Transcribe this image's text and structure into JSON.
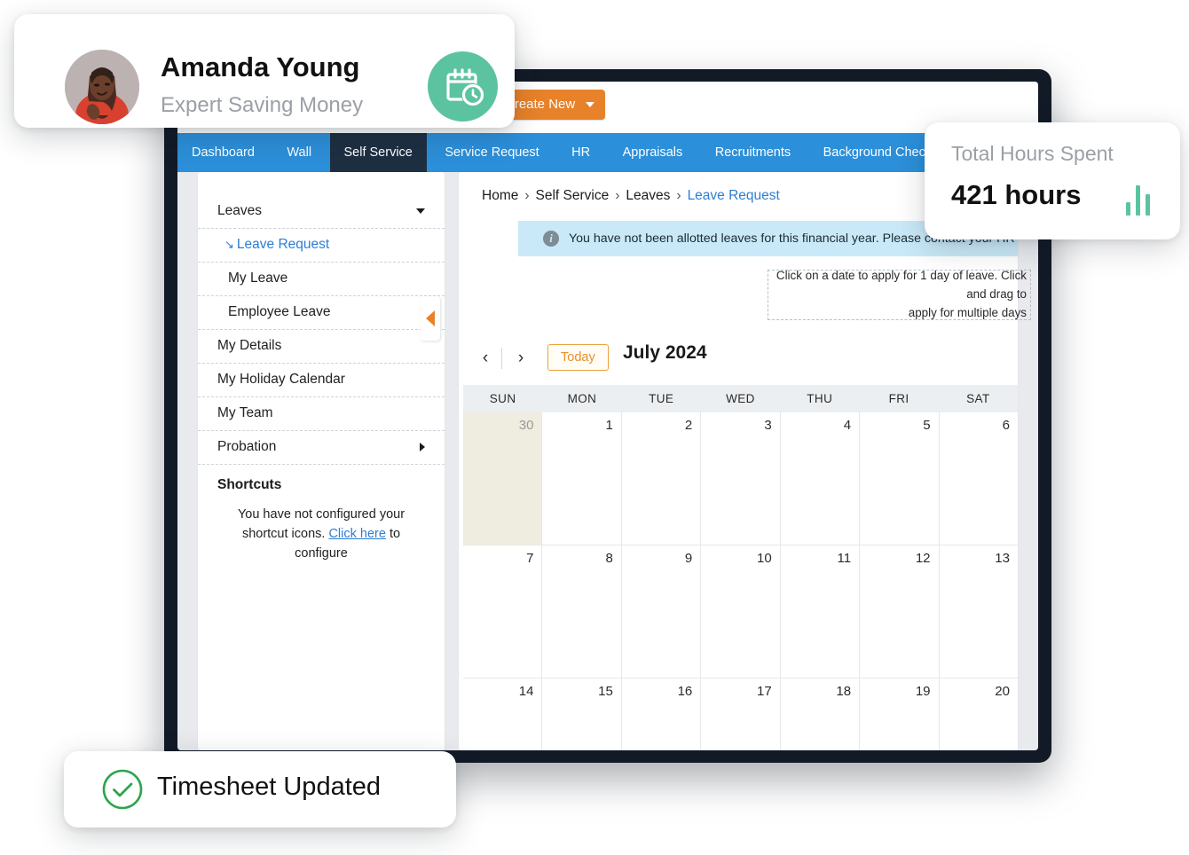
{
  "profile_card": {
    "name": "Amanda Young",
    "role": "Expert Saving Money",
    "badge_icon": "calendar-clock-icon",
    "avatar_icon": "user-avatar-photo",
    "badge_color": "#5cc3a0"
  },
  "hours_card": {
    "label": "Total Hours Spent",
    "value": "421 hours",
    "chart_icon": "bar-chart-icon",
    "accent_color": "#5cc3a0"
  },
  "toast": {
    "message": "Timesheet Updated",
    "icon": "check-circle-icon",
    "accent_color": "#2ba54f"
  },
  "topbar": {
    "create_new_label": "Create New",
    "create_new_color": "#e8822a"
  },
  "nav": {
    "active": "Self Service",
    "accent_color": "#2c8fd9",
    "active_color": "#1e2f42",
    "items": [
      {
        "label": "Dashboard",
        "active": false
      },
      {
        "label": "Wall",
        "active": false
      },
      {
        "label": "Self Service",
        "active": true
      },
      {
        "label": "Service Request",
        "active": false
      },
      {
        "label": "HR",
        "active": false
      },
      {
        "label": "Appraisals",
        "active": false
      },
      {
        "label": "Recruitments",
        "active": false
      },
      {
        "label": "Background Check",
        "active": false
      }
    ]
  },
  "sidebar": {
    "menu": [
      {
        "label": "Leaves",
        "type": "group",
        "caret": "down"
      },
      {
        "label": "Leave Request",
        "type": "sub",
        "active": true
      },
      {
        "label": "My Leave",
        "type": "sub",
        "active": false
      },
      {
        "label": "Employee Leave",
        "type": "sub",
        "active": false
      },
      {
        "label": "My Details",
        "type": "item"
      },
      {
        "label": "My Holiday Calendar",
        "type": "item"
      },
      {
        "label": "My Team",
        "type": "item"
      },
      {
        "label": "Probation",
        "type": "item",
        "caret": "right"
      }
    ],
    "shortcuts": {
      "title": "Shortcuts",
      "text_before": "You have not configured your shortcut icons. ",
      "link": "Click here",
      "text_after": " to configure"
    },
    "collapse_icon": "collapse-left-arrow-icon"
  },
  "content": {
    "breadcrumb": [
      "Home",
      "Self Service",
      "Leaves",
      "Leave Request"
    ],
    "breadcrumb_separator": "›",
    "alert": {
      "icon": "info-icon",
      "text": "You have not been allotted leaves for this financial year. Please contact your HR"
    },
    "hint": {
      "line1": "Click on a date to apply for 1 day of leave. Click and drag to",
      "line2": "apply for multiple days"
    },
    "calendar": {
      "prev_label": "‹",
      "next_label": "›",
      "today_label": "Today",
      "title": "July 2024",
      "weekday_headers": [
        "SUN",
        "MON",
        "TUE",
        "WED",
        "THU",
        "FRI",
        "SAT"
      ],
      "weeks": [
        [
          {
            "day": "30",
            "other_month": true,
            "highlight": true
          },
          {
            "day": "1",
            "other_month": false,
            "highlight": false
          },
          {
            "day": "2",
            "other_month": false,
            "highlight": false
          },
          {
            "day": "3",
            "other_month": false,
            "highlight": false
          },
          {
            "day": "4",
            "other_month": false,
            "highlight": false
          },
          {
            "day": "5",
            "other_month": false,
            "highlight": false
          },
          {
            "day": "6",
            "other_month": false,
            "highlight": false
          }
        ],
        [
          {
            "day": "7",
            "other_month": false,
            "highlight": false
          },
          {
            "day": "8",
            "other_month": false,
            "highlight": false
          },
          {
            "day": "9",
            "other_month": false,
            "highlight": false
          },
          {
            "day": "10",
            "other_month": false,
            "highlight": false
          },
          {
            "day": "11",
            "other_month": false,
            "highlight": false
          },
          {
            "day": "12",
            "other_month": false,
            "highlight": false
          },
          {
            "day": "13",
            "other_month": false,
            "highlight": false
          }
        ],
        [
          {
            "day": "14",
            "other_month": false,
            "highlight": false
          },
          {
            "day": "15",
            "other_month": false,
            "highlight": false
          },
          {
            "day": "16",
            "other_month": false,
            "highlight": false
          },
          {
            "day": "17",
            "other_month": false,
            "highlight": false
          },
          {
            "day": "18",
            "other_month": false,
            "highlight": false
          },
          {
            "day": "19",
            "other_month": false,
            "highlight": false
          },
          {
            "day": "20",
            "other_month": false,
            "highlight": false
          }
        ]
      ]
    }
  }
}
